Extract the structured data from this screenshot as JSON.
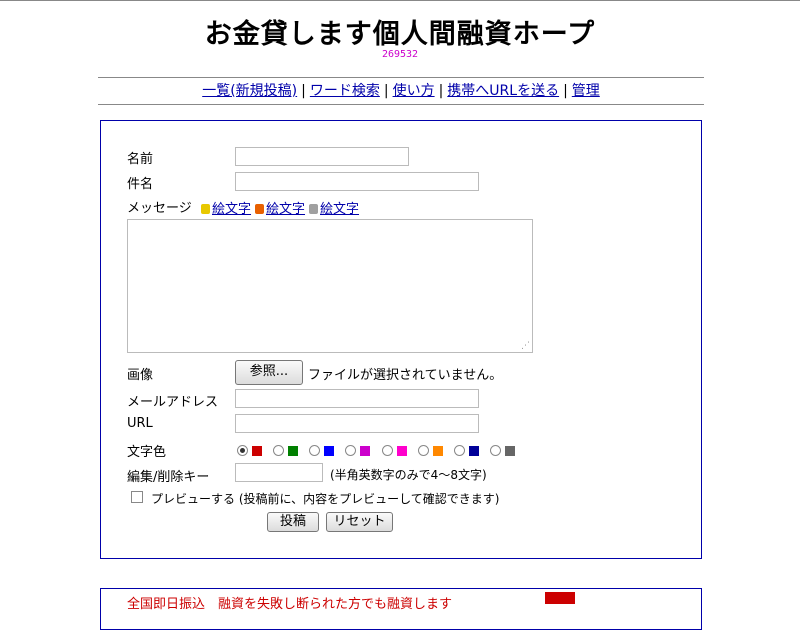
{
  "header": {
    "title": "お金貸します個人間融資ホープ",
    "counter": "269532"
  },
  "nav": {
    "items": [
      "一覧(新規投稿)",
      "ワード検索",
      "使い方",
      "携帯へURLを送る",
      "管理"
    ],
    "separator": "|"
  },
  "form": {
    "name_label": "名前",
    "subject_label": "件名",
    "message_label": "メッセージ",
    "emoji_links": [
      {
        "label": "絵文字",
        "icon_color": "#e8c800",
        "icon": "i-mode-emoji-icon"
      },
      {
        "label": "絵文字",
        "icon_color": "#e86000",
        "icon": "ezweb-emoji-icon"
      },
      {
        "label": "絵文字",
        "icon_color": "#a0a0a0",
        "icon": "softbank-emoji-icon"
      }
    ],
    "image_label": "画像",
    "browse_button": "参照...",
    "file_status": "ファイルが選択されていません。",
    "email_label": "メールアドレス",
    "url_label": "URL",
    "color_label": "文字色",
    "colors": [
      {
        "hex": "#cc0000",
        "selected": true
      },
      {
        "hex": "#008000",
        "selected": false
      },
      {
        "hex": "#0000ff",
        "selected": false
      },
      {
        "hex": "#cc00cc",
        "selected": false
      },
      {
        "hex": "#ff00cc",
        "selected": false
      },
      {
        "hex": "#ff8800",
        "selected": false
      },
      {
        "hex": "#000099",
        "selected": false
      },
      {
        "hex": "#666666",
        "selected": false
      }
    ],
    "edit_key_label": "編集/削除キー",
    "edit_key_hint": "(半角英数字のみで4～8文字)",
    "preview_label": "プレビューする (投稿前に、内容をプレビューして確認できます)",
    "submit_button": "投稿",
    "reset_button": "リセット"
  },
  "bottom": {
    "partial_text": "全国即日振込　融資を失敗し断られた方でも融資します"
  }
}
